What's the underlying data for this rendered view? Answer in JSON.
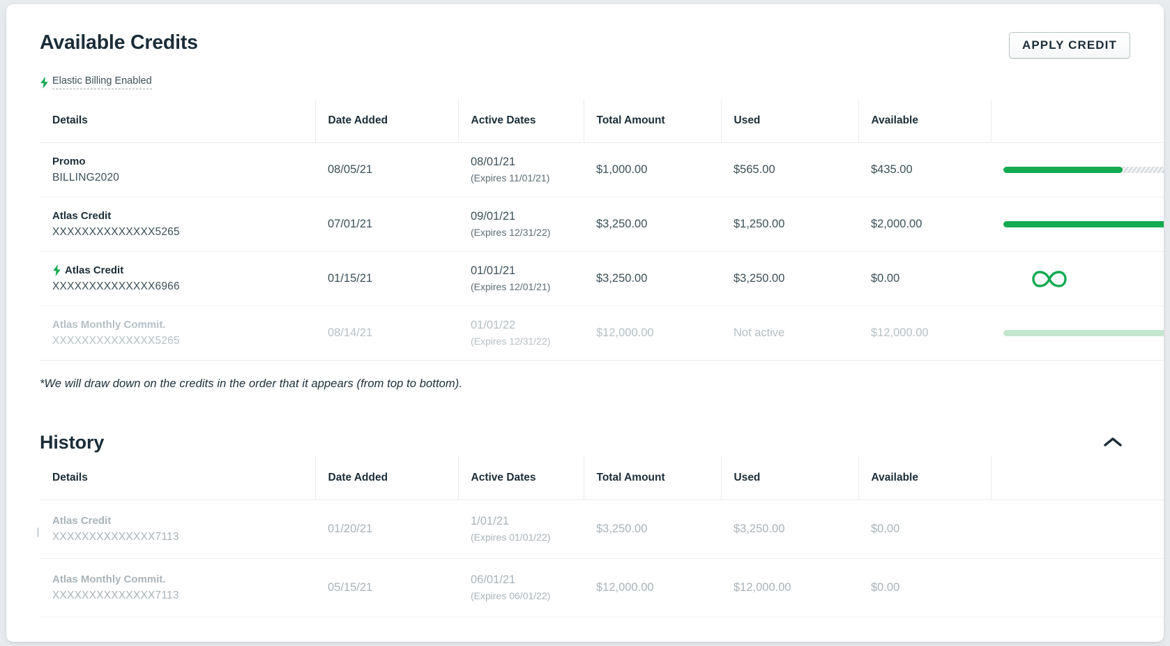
{
  "available": {
    "title": "Available Credits",
    "apply_button": "APPLY CREDIT",
    "elastic_badge": {
      "icon": "lightning-bolt-icon",
      "label": "Elastic Billing Enabled",
      "color": "#13aa52"
    },
    "columns": [
      "Details",
      "Date Added",
      "Active Dates",
      "Total Amount",
      "Used",
      "Available"
    ],
    "rows": [
      {
        "name": "Promo",
        "identifier": "BILLING2020",
        "elastic": false,
        "date_added": "08/05/21",
        "active_date": "08/01/21",
        "expires": "(Expires 11/01/21)",
        "total_amount": "$1,000.00",
        "used": "$565.00",
        "available": "$435.00",
        "bar": {
          "type": "striped",
          "percent": 56.5
        },
        "inactive": false
      },
      {
        "name": "Atlas Credit",
        "identifier": "XXXXXXXXXXXXXX5265",
        "elastic": false,
        "date_added": "07/01/21",
        "active_date": "09/01/21",
        "expires": "(Expires 12/31/22)",
        "total_amount": "$3,250.00",
        "used": "$1,250.00",
        "available": "$2,000.00",
        "bar": {
          "type": "striped",
          "percent": 80
        },
        "inactive": false
      },
      {
        "name": "Atlas Credit",
        "identifier": "XXXXXXXXXXXXXX6966",
        "elastic": true,
        "date_added": "01/15/21",
        "active_date": "01/01/21",
        "expires": "(Expires 12/01/21)",
        "total_amount": "$3,250.00",
        "used": "$3,250.00",
        "available": "$0.00",
        "bar": {
          "type": "infinity",
          "percent": 100
        },
        "inactive": false
      },
      {
        "name": "Atlas Monthly Commit.",
        "identifier": "XXXXXXXXXXXXXX5265",
        "elastic": false,
        "date_added": "08/14/21",
        "active_date": "01/01/22",
        "expires": "(Expires 12/31/22)",
        "total_amount": "$12,000.00",
        "used": "Not active",
        "available": "$12,000.00",
        "bar": {
          "type": "flat",
          "percent": 100
        },
        "inactive": true
      }
    ],
    "footnote": "*We will draw down on the credits in the order that it appears (from top to bottom)."
  },
  "history": {
    "title": "History",
    "collapse_icon": "chevron-up-icon",
    "columns": [
      "Details",
      "Date Added",
      "Active Dates",
      "Total Amount",
      "Used",
      "Available"
    ],
    "rows": [
      {
        "name": "Atlas Credit",
        "identifier": "XXXXXXXXXXXXXX7113",
        "date_added": "01/20/21",
        "active_date": "1/01/21",
        "expires": "(Expires 01/01/22)",
        "total_amount": "$3,250.00",
        "used": "$3,250.00",
        "available": "$0.00"
      },
      {
        "name": "Atlas Monthly Commit.",
        "identifier": "XXXXXXXXXXXXXX7113",
        "date_added": "05/15/21",
        "active_date": "06/01/21",
        "expires": "(Expires 06/01/22)",
        "total_amount": "$12,000.00",
        "used": "$12,000.00",
        "available": "$0.00"
      }
    ]
  },
  "theme": {
    "accent_green": "#13aa52",
    "text_dark": "#1c2d38",
    "text_muted": "#3d4f58",
    "text_disabled": "#b6bfc4",
    "border": "#e8edeb",
    "bar_pale_green": "#c3e6cf"
  }
}
